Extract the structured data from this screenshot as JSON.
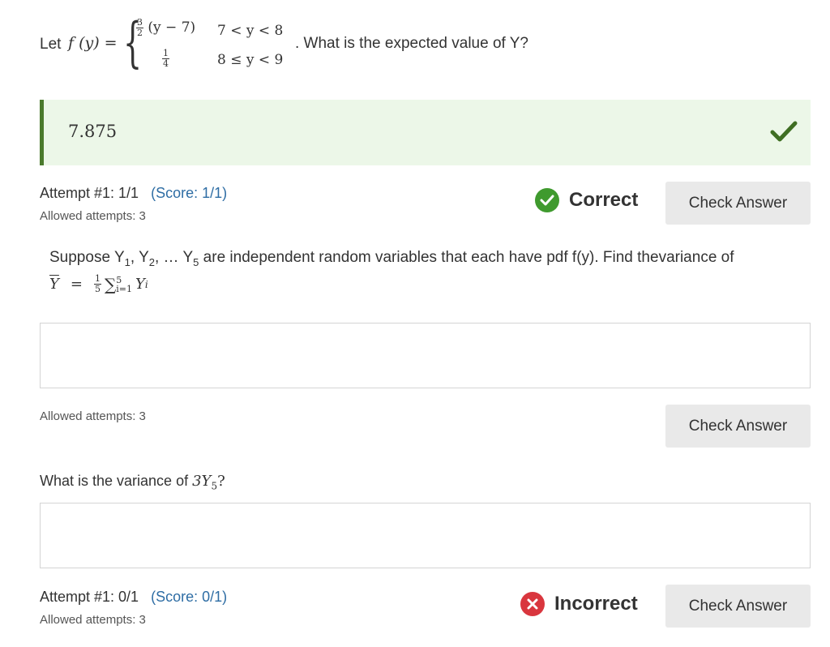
{
  "q1": {
    "let": "Let",
    "fy": "f (y) =",
    "case1_num": "3",
    "case1_den": "2",
    "case1_expr": "(y − 7)",
    "case1_cond": "7 < y < 8",
    "case2_num": "1",
    "case2_den": "4",
    "case2_cond": "8 ≤ y < 9",
    "tail": ". What is the expected value of Y?",
    "answer": "7.875",
    "attempt": "Attempt #1: 1/1",
    "score": "(Score: 1/1)",
    "allowed": "Allowed attempts: 3",
    "status": "Correct",
    "button": "Check Answer"
  },
  "q2": {
    "text_a": "Suppose Y",
    "sub1": "1",
    "text_b": ", Y",
    "sub2": "2",
    "text_c": ", … Y",
    "sub5": "5",
    "text_d": " are independent random variables that each have pdf f(y). Find thevariance of",
    "math_lhs": "Y",
    "math_eq": "=",
    "math_num": "1",
    "math_den": "5",
    "math_sum": "∑",
    "math_sum_top": "5",
    "math_sum_bot": "i=1",
    "math_yi": "Y",
    "math_yi_sub": "i",
    "allowed": "Allowed attempts: 3",
    "button": "Check Answer"
  },
  "q3": {
    "text": "What is the variance of",
    "math": "3Y",
    "math_sub": "5",
    "math_q": "?",
    "attempt": "Attempt #1: 0/1",
    "score": "(Score: 0/1)",
    "allowed": "Allowed attempts: 3",
    "status": "Incorrect",
    "button": "Check Answer"
  },
  "colors": {
    "correct_bg": "#ecf7e8",
    "correct_bar": "#4a7a2c",
    "correct_icon": "#3f9a2e",
    "incorrect_icon": "#d9363e",
    "score_link": "#2e6da4",
    "button_bg": "#e9e9e9"
  }
}
